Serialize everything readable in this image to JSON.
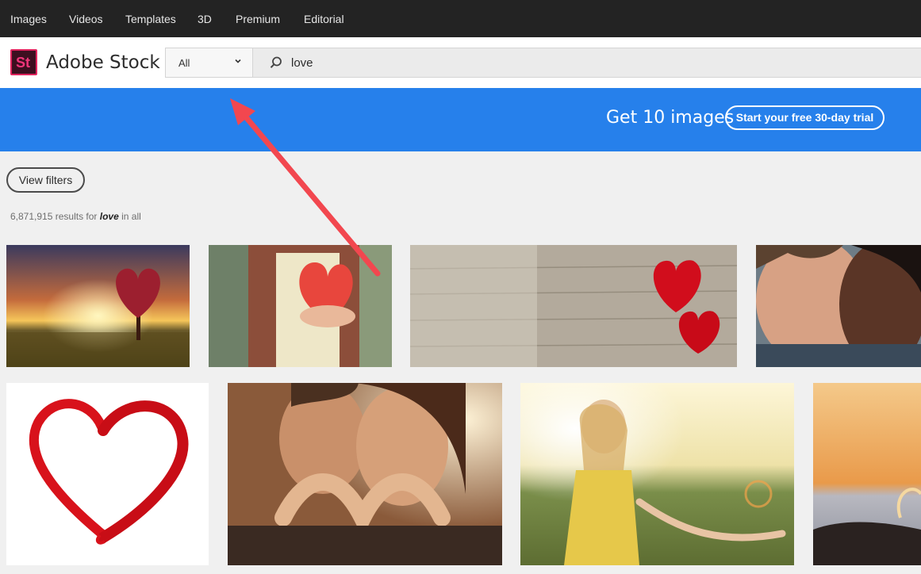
{
  "topnav": {
    "items": [
      "Images",
      "Videos",
      "Templates",
      "3D",
      "Premium",
      "Editorial"
    ]
  },
  "header": {
    "logo_text": "St",
    "brand": "Adobe Stock",
    "search": {
      "category": "All",
      "query": "love"
    }
  },
  "banner": {
    "text": "Get 10 images",
    "cta": "Start your free 30-day trial"
  },
  "filters_label": "View filters",
  "results": {
    "count": "6,871,915 results for",
    "term": "love",
    "suffix": "in all"
  },
  "colors": {
    "topnav_bg": "#232323",
    "banner_bg": "#2680eb",
    "brand_pink": "#e0245e",
    "annotation_arrow": "#f2474f"
  },
  "thumbnails": [
    "heart-shaped-tree-sunset",
    "couple-holding-paper-heart",
    "red-hearts-on-wood",
    "couple-kissing",
    "red-heart-swoosh",
    "couple-making-heart-hands",
    "couple-holding-hands-field",
    "book-heart-sunset"
  ]
}
